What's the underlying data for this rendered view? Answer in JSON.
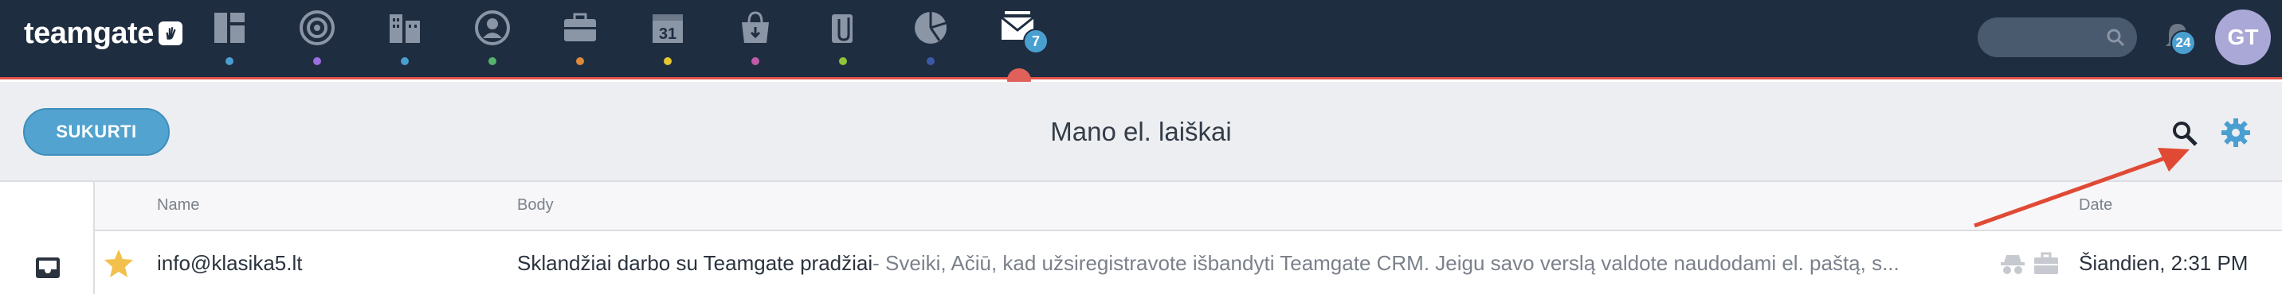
{
  "app": {
    "logo_text": "teamgate"
  },
  "nav": {
    "items": [
      {
        "name": "dashboard",
        "icon": "dashboard-icon",
        "dot_color": "#4a9fd1"
      },
      {
        "name": "leads",
        "icon": "target-icon",
        "dot_color": "#9b6fe0"
      },
      {
        "name": "companies",
        "icon": "buildings-icon",
        "dot_color": "#4a9fd1"
      },
      {
        "name": "people",
        "icon": "person-icon",
        "dot_color": "#55b26a"
      },
      {
        "name": "deals",
        "icon": "briefcase-icon",
        "dot_color": "#e0883a"
      },
      {
        "name": "calendar",
        "icon": "calendar-icon",
        "dot_color": "#e5c72e",
        "label": "31"
      },
      {
        "name": "sales",
        "icon": "bag-icon",
        "dot_color": "#c15aa8"
      },
      {
        "name": "files",
        "icon": "paperclip-icon",
        "dot_color": "#8fc43a"
      },
      {
        "name": "reports",
        "icon": "pie-chart-icon",
        "dot_color": "#3a5aa8"
      },
      {
        "name": "emails",
        "icon": "envelope-icon",
        "badge": "7",
        "active": true
      }
    ],
    "notifications_count": "24",
    "avatar_initials": "GT"
  },
  "toolbar": {
    "create_label": "SUKURTI",
    "title": "Mano el. laiškai"
  },
  "table": {
    "columns": [
      "Name",
      "Body",
      "Date"
    ],
    "rows": [
      {
        "starred": true,
        "name": "info@klasika5.lt",
        "subject": "Sklandžiai darbo su Teamgate pradžiai",
        "snippet": "- Sveiki,  Ačiū, kad užsiregistravote išbandyti Teamgate CRM.  Jeigu savo verslą valdote naudodami el. paštą, s...",
        "date": "Šiandien, 2:31 PM"
      }
    ]
  },
  "colors": {
    "topbar": "#1f2d40",
    "accent": "#52a3cf",
    "active_indicator": "#e0615a",
    "annotation_arrow": "#e04a35"
  }
}
